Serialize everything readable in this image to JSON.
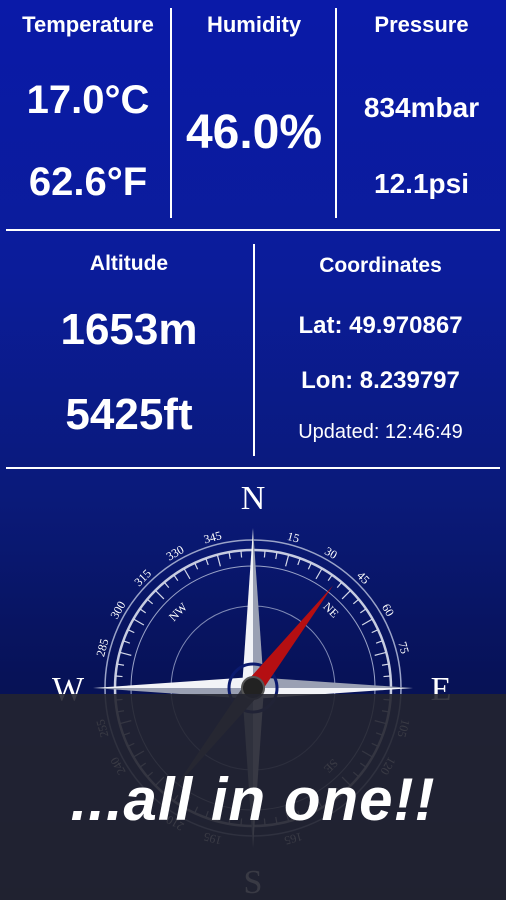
{
  "temperature": {
    "title": "Temperature",
    "celsius": "17.0°C",
    "fahrenheit": "62.6°F"
  },
  "humidity": {
    "title": "Humidity",
    "value": "46.0%"
  },
  "pressure": {
    "title": "Pressure",
    "mbar": "834mbar",
    "psi": "12.1psi"
  },
  "altitude": {
    "title": "Altitude",
    "meters": "1653m",
    "feet": "5425ft"
  },
  "coordinates": {
    "title": "Coordinates",
    "lat": "Lat: 49.970867",
    "lon": "Lon: 8.239797",
    "updated": "Updated: 12:46:49"
  },
  "compass": {
    "north": "N",
    "east": "E",
    "south": "S",
    "west": "W",
    "northwest": "NW",
    "northeast": "NE",
    "southeast": "SE",
    "degrees": [
      "15",
      "30",
      "45",
      "60",
      "75",
      "105",
      "120",
      "165",
      "195",
      "210",
      "240",
      "255",
      "285",
      "300",
      "315",
      "330",
      "345"
    ],
    "heading_degrees": 38
  },
  "tagline": "...all in one!!"
}
